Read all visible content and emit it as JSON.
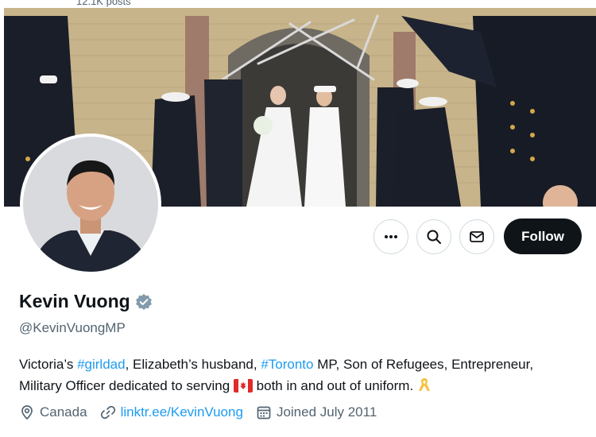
{
  "profile": {
    "posts_count": "12.1K posts",
    "display_name": "Kevin Vuong",
    "verified": true,
    "handle": "@KevinVuongMP",
    "bio": {
      "part1": "Victoria’s ",
      "tag1": "#girldad",
      "part2": ", Elizabeth’s husband, ",
      "tag2": "#Toronto",
      "part3": " MP, Son of Refugees, Entrepreneur,",
      "line2": "Military Officer dedicated to serving",
      "part4": "both in and out of uniform."
    },
    "location": "Canada",
    "link": "linktr.ee/KevinVuong",
    "joined": "Joined July 2011"
  },
  "actions": {
    "follow_label": "Follow"
  },
  "colors": {
    "accent": "#1d9bf0",
    "text_primary": "#0f1419",
    "text_secondary": "#536471",
    "button_dark": "#0f1419",
    "verified_badge": "#829aab"
  },
  "icons": {
    "more": "more-horizontal-icon",
    "search": "search-icon",
    "message": "envelope-icon",
    "verified": "verified-badge-icon",
    "location": "location-pin-icon",
    "link": "link-icon",
    "calendar": "calendar-icon",
    "flag": "canada-flag-icon",
    "ribbon": "yellow-ribbon-icon"
  }
}
